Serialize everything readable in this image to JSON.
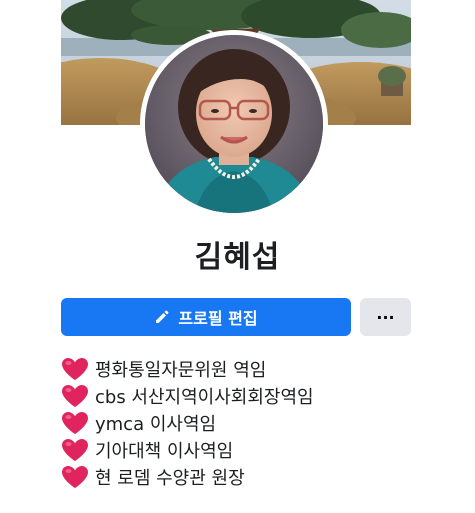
{
  "profile": {
    "name": "김혜섭"
  },
  "actions": {
    "edit_label": "프로필 편집",
    "more_label": "···"
  },
  "bio": [
    {
      "icon": "red-heart-icon",
      "text": "평화통일자문위원 역임"
    },
    {
      "icon": "red-heart-icon",
      "text": "cbs 서산지역이사회회장역임"
    },
    {
      "icon": "red-heart-icon",
      "text": "ymca 이사역임"
    },
    {
      "icon": "red-heart-icon",
      "text": "기아대책 이사역임"
    },
    {
      "icon": "red-heart-icon",
      "text": "현 로뎀 수양관 원장"
    }
  ],
  "colors": {
    "primary": "#1877f2",
    "secondary_button": "#e4e6eb",
    "heart": "#e0245e",
    "text": "#1c1e21"
  }
}
